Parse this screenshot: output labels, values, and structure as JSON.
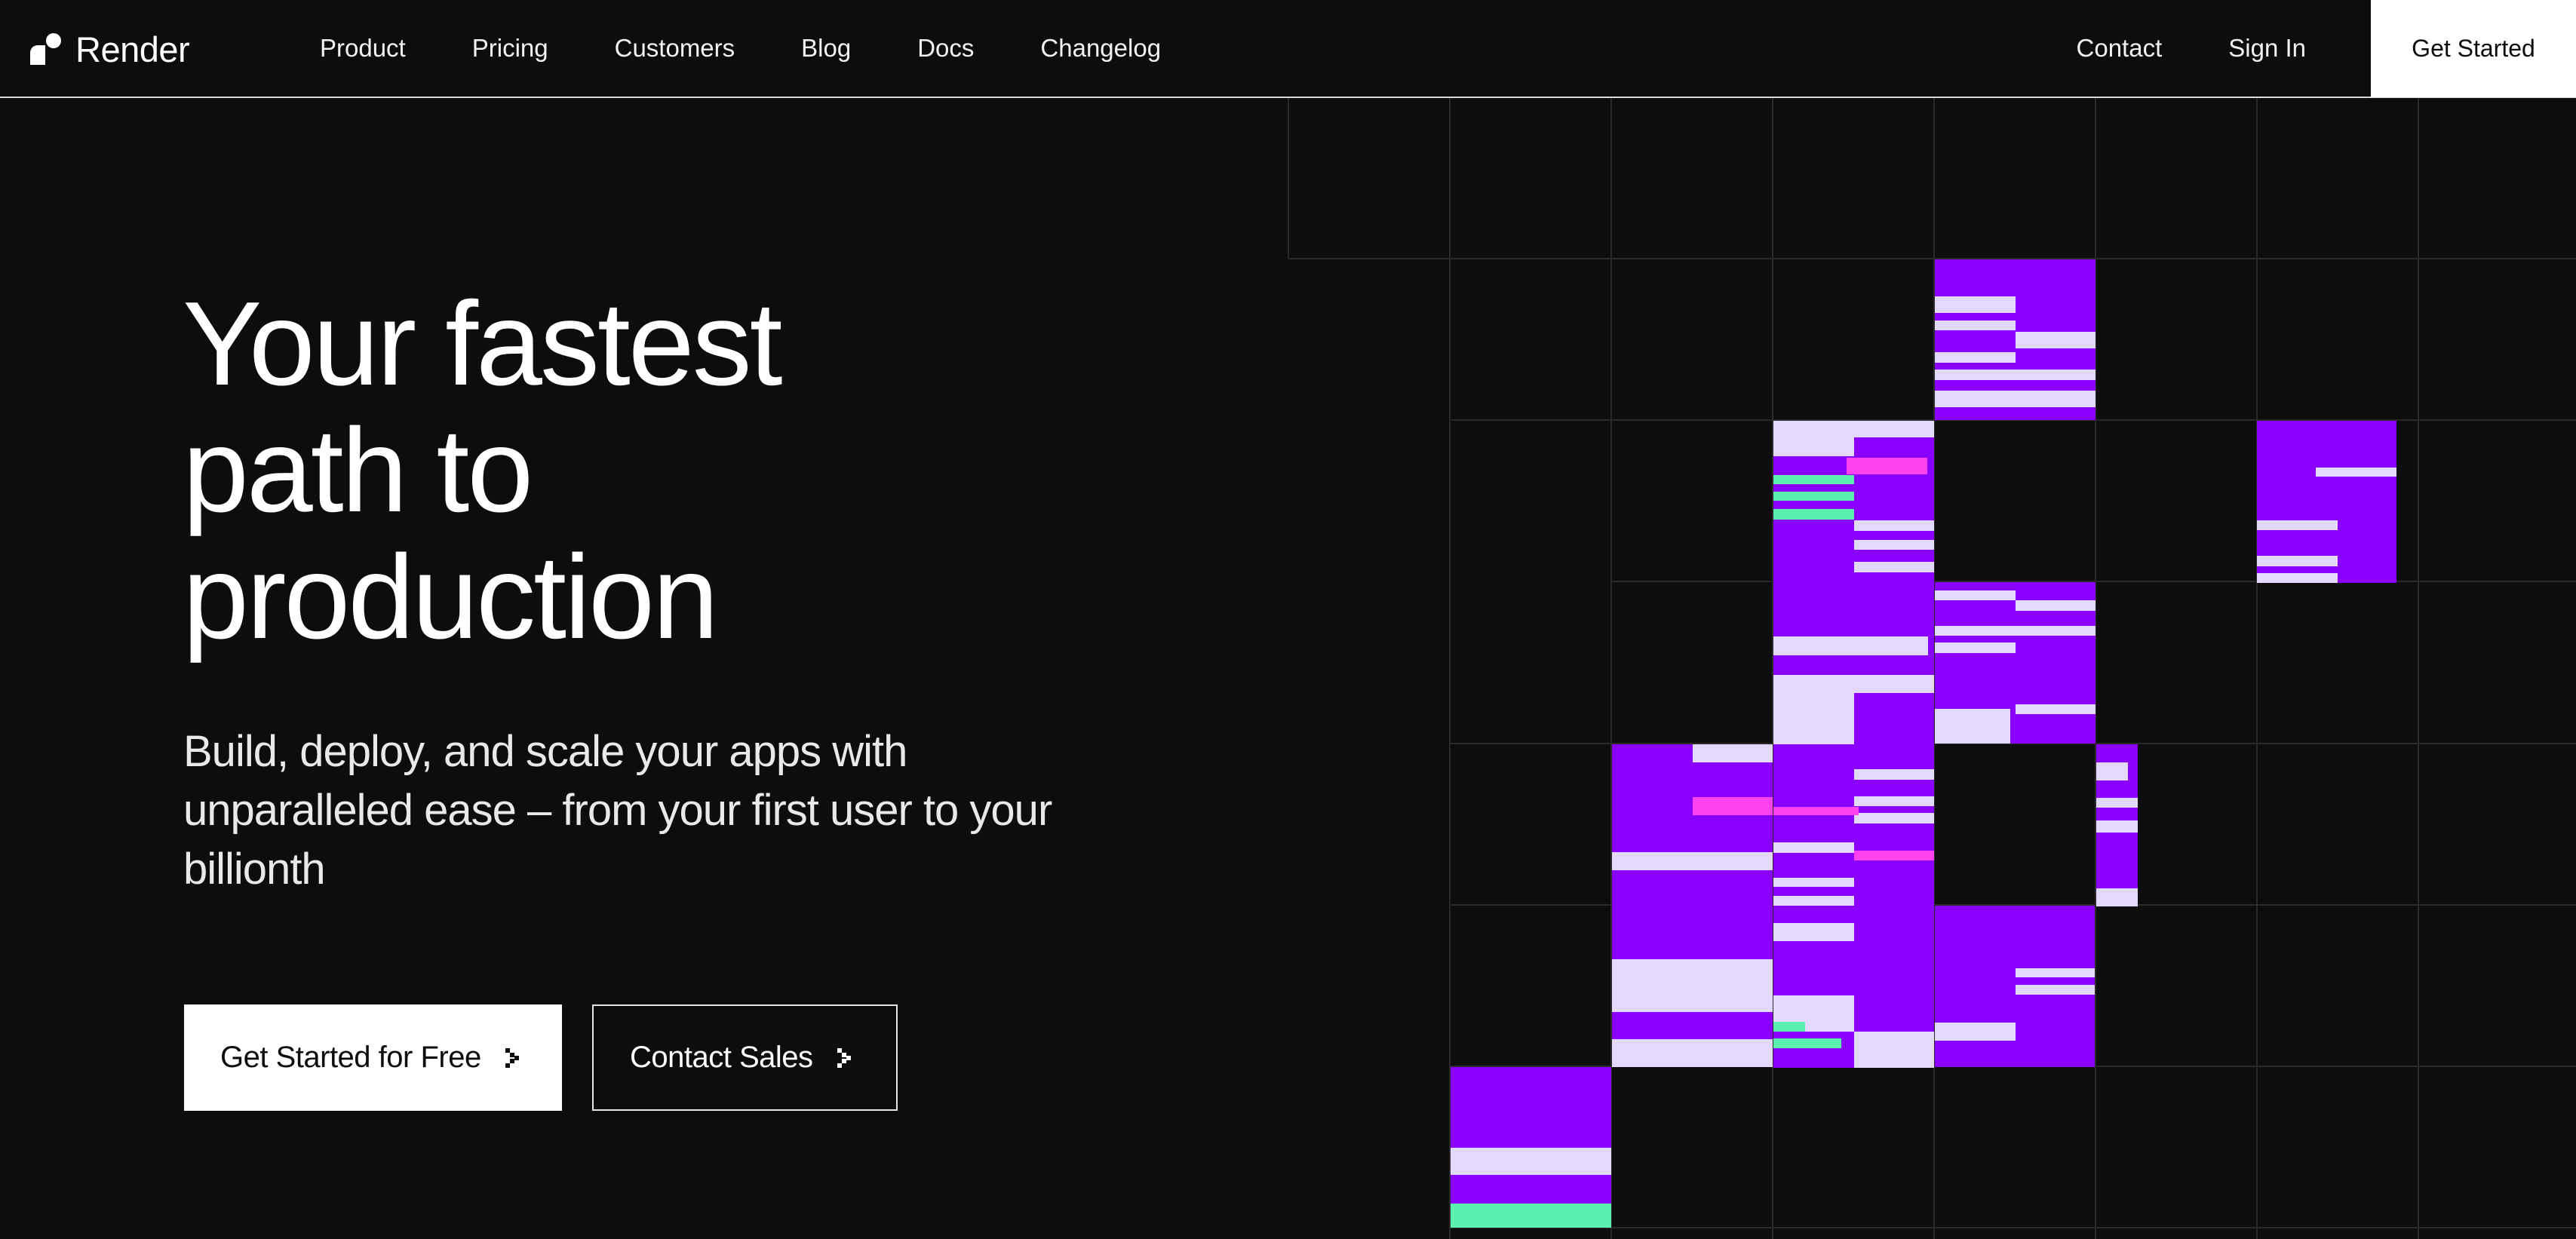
{
  "brand": {
    "name": "Render",
    "icon": "render-logo-icon"
  },
  "nav": {
    "links": [
      "Product",
      "Pricing",
      "Customers",
      "Blog",
      "Docs",
      "Changelog"
    ],
    "contact": "Contact",
    "sign_in": "Sign In",
    "cta": "Get Started"
  },
  "hero": {
    "title_lines": [
      "Your fastest",
      "path to",
      "production"
    ],
    "subtitle_lines": [
      "Build, deploy, and scale your apps with",
      "unparalleled ease – from your first user to your",
      "billionth"
    ],
    "primary_button": "Get Started for Free",
    "secondary_button": "Contact Sales",
    "button_icon": "chevron-right-icon"
  },
  "colors": {
    "background": "#0d0d0d",
    "purple": "#8a00ff",
    "lavender": "#e3d9ff",
    "green": "#5cf0b0",
    "pink": "#ff42f0"
  }
}
